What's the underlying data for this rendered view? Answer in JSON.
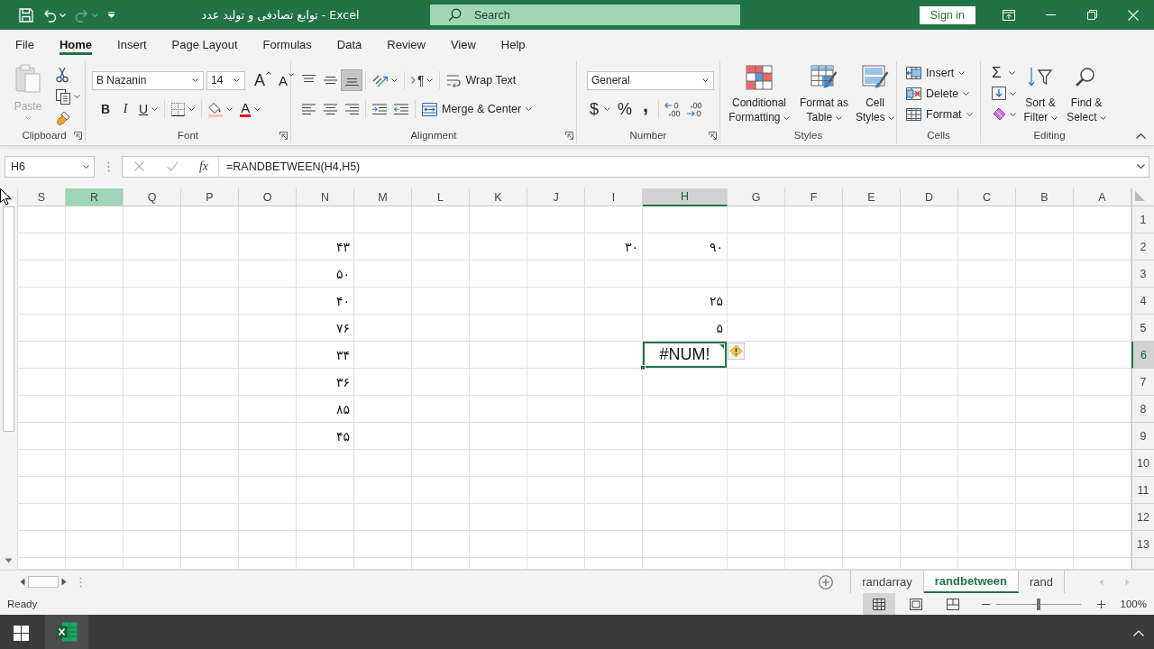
{
  "title_bar": {
    "quick_access": [
      {
        "kind": "save",
        "disabled": false
      },
      {
        "kind": "undo",
        "disabled": false
      },
      {
        "kind": "redo",
        "disabled": true
      },
      {
        "kind": "customize",
        "disabled": false
      }
    ],
    "title": "توابع تصادفی و تولید عدد  -  Excel",
    "search": {
      "placeholder": "Search"
    },
    "sign_in": "Sign in"
  },
  "ribbon": {
    "tabs": [
      {
        "label": "File",
        "selected": false
      },
      {
        "label": "Home",
        "selected": true
      },
      {
        "label": "Insert",
        "selected": false
      },
      {
        "label": "Page Layout",
        "selected": false
      },
      {
        "label": "Formulas",
        "selected": false
      },
      {
        "label": "Data",
        "selected": false
      },
      {
        "label": "Review",
        "selected": false
      },
      {
        "label": "View",
        "selected": false
      },
      {
        "label": "Help",
        "selected": false
      }
    ],
    "groups": [
      {
        "kind": "clipboard",
        "label": "Clipboard",
        "launcher": true,
        "paste": "Paste",
        "paste_disabled": true
      },
      {
        "kind": "font",
        "label": "Font",
        "launcher": true,
        "font_name": "B Nazanin",
        "font_size": "14",
        "grow": "A",
        "shrink": "A",
        "styles": [
          {
            "kind": "bold",
            "glyph": "B"
          },
          {
            "kind": "italic",
            "glyph": "I"
          },
          {
            "kind": "underline",
            "glyph": "U"
          }
        ],
        "font_color": "A"
      },
      {
        "kind": "alignment",
        "label": "Alignment",
        "launcher": true,
        "bottom_align_selected": true,
        "text_direction": "¶",
        "wrap_text": "Wrap Text",
        "merge": "Merge & Center"
      },
      {
        "kind": "number",
        "label": "Number",
        "launcher": true,
        "format": "General",
        "currency": "$",
        "percent": "%",
        "comma": ","
      },
      {
        "kind": "styles",
        "label": "Styles",
        "launcher": false,
        "buttons": [
          "Conditional Formatting",
          "Format as Table",
          "Cell Styles"
        ]
      },
      {
        "kind": "cells",
        "label": "Cells",
        "launcher": false,
        "buttons": [
          "Insert",
          "Delete",
          "Format"
        ]
      },
      {
        "kind": "editing",
        "label": "Editing",
        "launcher": false,
        "autosum": "Σ",
        "buttons": [
          "Sort & Filter",
          "Find & Select"
        ]
      }
    ]
  },
  "formula_bar": {
    "name_box": "H6",
    "function_label": "fx",
    "formula": "=RANDBETWEEN(H4,H5)"
  },
  "sheet": {
    "columns": [
      {
        "label": "S",
        "selected": false,
        "hovered": false
      },
      {
        "label": "R",
        "selected": false,
        "hovered": true
      },
      {
        "label": "Q",
        "selected": false,
        "hovered": false
      },
      {
        "label": "P",
        "selected": false,
        "hovered": false
      },
      {
        "label": "O",
        "selected": false,
        "hovered": false
      },
      {
        "label": "N",
        "selected": false,
        "hovered": false
      },
      {
        "label": "M",
        "selected": false,
        "hovered": false
      },
      {
        "label": "L",
        "selected": false,
        "hovered": false
      },
      {
        "label": "K",
        "selected": false,
        "hovered": false
      },
      {
        "label": "J",
        "selected": false,
        "hovered": false
      },
      {
        "label": "I",
        "selected": false,
        "hovered": false
      },
      {
        "label": "H",
        "selected": true,
        "hovered": false
      },
      {
        "label": "G",
        "selected": false,
        "hovered": false
      },
      {
        "label": "F",
        "selected": false,
        "hovered": false
      },
      {
        "label": "E",
        "selected": false,
        "hovered": false
      },
      {
        "label": "D",
        "selected": false,
        "hovered": false
      },
      {
        "label": "C",
        "selected": false,
        "hovered": false
      },
      {
        "label": "B",
        "selected": false,
        "hovered": false
      },
      {
        "label": "A",
        "selected": false,
        "hovered": false
      }
    ],
    "rows": [
      {
        "label": "1",
        "selected": false
      },
      {
        "label": "2",
        "selected": false,
        "cells": {
          "N": {
            "value": "۴۳",
            "kind": "number",
            "selected": false
          },
          "I": {
            "value": "۳۰",
            "kind": "number",
            "selected": false
          },
          "H": {
            "value": "۹۰",
            "kind": "number",
            "selected": false
          }
        }
      },
      {
        "label": "3",
        "selected": false,
        "cells": {
          "N": {
            "value": "۵۰",
            "kind": "number",
            "selected": false
          }
        }
      },
      {
        "label": "4",
        "selected": false,
        "cells": {
          "N": {
            "value": "۴۰",
            "kind": "number",
            "selected": false
          },
          "H": {
            "value": "۲۵",
            "kind": "number",
            "selected": false
          }
        }
      },
      {
        "label": "5",
        "selected": false,
        "cells": {
          "N": {
            "value": "۷۶",
            "kind": "number",
            "selected": false
          },
          "H": {
            "value": "۵",
            "kind": "number",
            "selected": false
          }
        }
      },
      {
        "label": "6",
        "selected": true,
        "cells": {
          "N": {
            "value": "۳۴",
            "kind": "number",
            "selected": false
          },
          "H": {
            "value": "#NUM!",
            "kind": "error",
            "selected": true
          }
        }
      },
      {
        "label": "7",
        "selected": false,
        "cells": {
          "N": {
            "value": "۳۶",
            "kind": "number",
            "selected": false
          }
        }
      },
      {
        "label": "8",
        "selected": false,
        "cells": {
          "N": {
            "value": "۸۵",
            "kind": "number",
            "selected": false
          }
        }
      },
      {
        "label": "9",
        "selected": false,
        "cells": {
          "N": {
            "value": "۴۵",
            "kind": "number",
            "selected": false
          }
        }
      },
      {
        "label": "10",
        "selected": false
      },
      {
        "label": "11",
        "selected": false
      },
      {
        "label": "12",
        "selected": false
      },
      {
        "label": "13",
        "selected": false
      }
    ]
  },
  "sheet_tabs": {
    "tabs": [
      {
        "label": "randarray",
        "selected": false
      },
      {
        "label": "randbetween",
        "selected": true
      },
      {
        "label": "rand",
        "selected": false
      }
    ]
  },
  "status_bar": {
    "text": "Ready",
    "views": [
      {
        "kind": "normal",
        "selected": true
      },
      {
        "kind": "page_layout",
        "selected": false
      },
      {
        "kind": "page_break",
        "selected": false
      }
    ],
    "zoom": {
      "level": 0.5,
      "label": "100%"
    }
  },
  "taskbar": {
    "apps": [
      {
        "kind": "spreadsheet",
        "active": true
      }
    ]
  }
}
